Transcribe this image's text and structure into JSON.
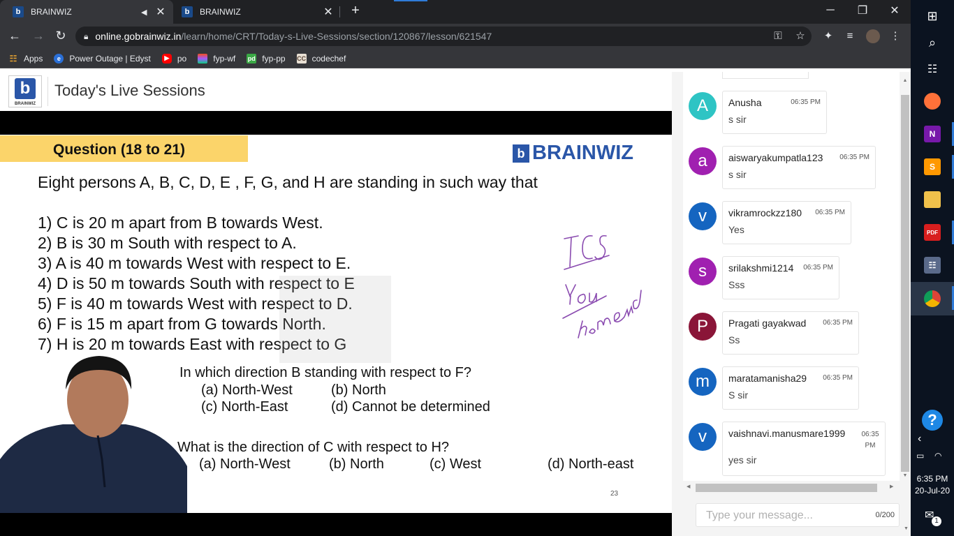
{
  "browser": {
    "tabs": [
      {
        "title": "BRAINWIZ",
        "active": true,
        "audio": true
      },
      {
        "title": "BRAINWIZ",
        "active": false,
        "audio": false
      }
    ],
    "new_tab": "+",
    "url_domain": "online.gobrainwiz.in",
    "url_path": "/learn/home/CRT/Today-s-Live-Sessions/section/120867/lesson/621547",
    "bookmarks": [
      {
        "label": "Apps",
        "icon": "apps-grid-icon"
      },
      {
        "label": "Power Outage | Edyst",
        "icon": "edyst-icon"
      },
      {
        "label": "po",
        "icon": "youtube-icon"
      },
      {
        "label": "fyp-wf",
        "icon": "figma-icon"
      },
      {
        "label": "fyp-pp",
        "icon": "pdf-icon"
      },
      {
        "label": "codechef",
        "icon": "codechef-icon"
      }
    ]
  },
  "page": {
    "brand_small": "BRAINWIZ",
    "title": "Today's Live Sessions"
  },
  "slide": {
    "heading": "Question (18 to 21)",
    "brand": "BRAINWIZ",
    "intro": "Eight persons A, B, C, D, E , F, G, and H are standing in such way that",
    "statements": [
      "1) C is 20 m apart from B towards West.",
      "2) B is 30 m South with respect to A.",
      "3) A is 40 m towards West with respect to E.",
      "4) D is 50 m towards South with respect to E",
      "5) F is 40 m towards West with respect to D.",
      "6) F is 15 m apart from G towards North.",
      "7) H is 20 m towards East with respect to G"
    ],
    "q1": "In which direction B standing with respect to F?",
    "q1_opts": [
      "(a) North-West",
      "(b) North",
      "(c) North-East",
      "(d) Cannot be determined"
    ],
    "q2": "What is the direction of C with respect to H?",
    "q2_opts": [
      "(a) North-West",
      "(b) North",
      "(c) West",
      "(d) North-east"
    ],
    "handwriting": [
      "TCS",
      "You",
      "homework"
    ],
    "page_number": "23"
  },
  "chat": {
    "messages": [
      {
        "initial": "A",
        "color": "#2ec4c4",
        "name": "Anusha",
        "time": "06:35 PM",
        "text": "s sir"
      },
      {
        "initial": "a",
        "color": "#a020b0",
        "name": "aiswaryakumpatla123",
        "time": "06:35 PM",
        "text": "s sir"
      },
      {
        "initial": "v",
        "color": "#1565c0",
        "name": "vikramrockzz180",
        "time": "06:35 PM",
        "text": "Yes"
      },
      {
        "initial": "s",
        "color": "#a020b0",
        "name": "srilakshmi1214",
        "time": "06:35 PM",
        "text": "Sss"
      },
      {
        "initial": "P",
        "color": "#8a1538",
        "name": "Pragati gayakwad",
        "time": "06:35 PM",
        "text": "Ss"
      },
      {
        "initial": "m",
        "color": "#1565c0",
        "name": "maratamanisha29",
        "time": "06:35 PM",
        "text": "S sir"
      },
      {
        "initial": "v",
        "color": "#1565c0",
        "name": "vaishnavi.manusmare1999",
        "time": "06:35 PM",
        "text": "yes sir"
      }
    ],
    "input_placeholder": "Type your message...",
    "char_count": "0/200"
  },
  "taskbar": {
    "time": "6:35 PM",
    "date": "20-Jul-20",
    "notification_count": "1"
  }
}
